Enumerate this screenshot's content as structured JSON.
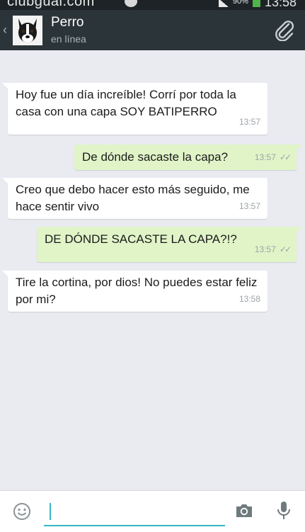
{
  "status_bar": {
    "watermark": "clubgual.com",
    "battery": "90%",
    "time": "13:58"
  },
  "header": {
    "contact_name": "Perro",
    "contact_status": "en línea",
    "icons": [
      "back-icon",
      "dog-avatar",
      "paperclip-icon"
    ]
  },
  "messages": [
    {
      "direction": "in",
      "text": "Hoy fue un día increíble! Corrí por toda la casa con una capa SOY BATIPERRO",
      "time": "13:57"
    },
    {
      "direction": "out",
      "text": "De dónde sacaste la capa?",
      "time": "13:57",
      "status": "read"
    },
    {
      "direction": "in",
      "text": "Creo que debo hacer esto más seguido, me hace sentir vivo",
      "time": "13:57"
    },
    {
      "direction": "out",
      "text": "DE DÓNDE SACASTE LA CAPA?!?",
      "time": "13:57",
      "status": "read"
    },
    {
      "direction": "in",
      "text": "Tire la cortina, por dios! No puedes estar feliz por mi?",
      "time": "13:58"
    }
  ],
  "input_bar": {
    "message_value": "",
    "icons": [
      "emoji-icon",
      "camera-icon",
      "microphone-icon"
    ]
  },
  "colors": {
    "header_bg": "#2b3438",
    "chat_bg": "#e9ebf1",
    "incoming_bubble": "#ffffff",
    "outgoing_bubble": "#e1f4c8",
    "accent": "#34b7c5"
  }
}
